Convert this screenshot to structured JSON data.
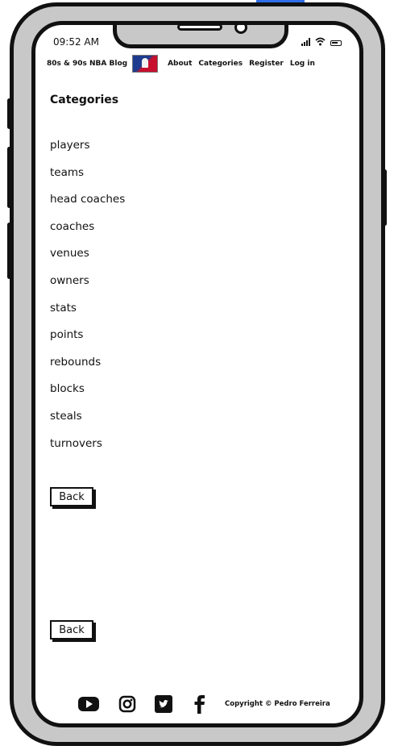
{
  "status": {
    "time": "09:52 AM"
  },
  "nav": {
    "brand": "80s & 90s NBA Blog",
    "links": [
      "About",
      "Categories",
      "Register",
      "Log in"
    ]
  },
  "page": {
    "title": "Categories",
    "categories": [
      "players",
      "teams",
      "head coaches",
      "coaches",
      "venues",
      "owners",
      "stats",
      "points",
      "rebounds",
      "blocks",
      "steals",
      "turnovers"
    ],
    "back_label_top": "Back",
    "back_label_bottom": "Back"
  },
  "footer": {
    "social": [
      "youtube-icon",
      "instagram-icon",
      "twitter-icon",
      "facebook-icon"
    ],
    "copyright": "Copyright © Pedro Ferreira"
  },
  "colors": {
    "frame": "#c8c8c8",
    "ink": "#111111",
    "accent_bar": "#2f6ee8"
  }
}
